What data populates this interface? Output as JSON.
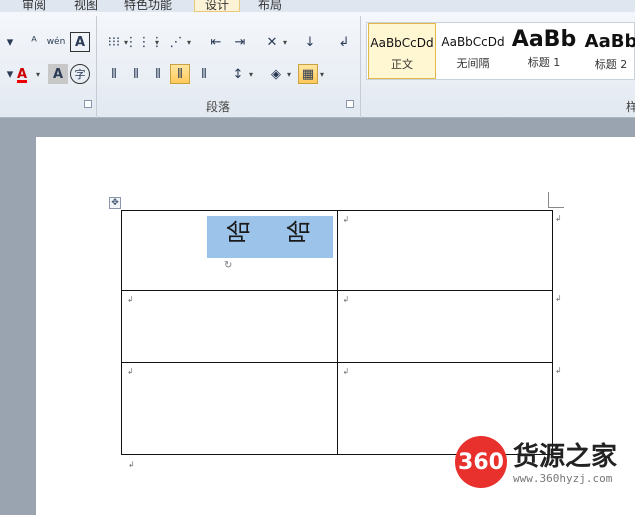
{
  "tabs": [
    "审阅",
    "视图",
    "特色功能",
    "设计",
    "布局"
  ],
  "ribbon": {
    "paragraph_group_label": "段落",
    "styles_group_label_partial": "样",
    "styles": [
      {
        "sample": "AaBbCcDd",
        "name": "正文",
        "selected": true
      },
      {
        "sample": "AaBbCcDd",
        "name": "无间隔",
        "selected": false
      },
      {
        "sample": "AaBb",
        "name": "标题 1",
        "selected": false
      },
      {
        "sample": "AaBb",
        "name": "标题 2",
        "selected": false
      }
    ],
    "font_buttons": {
      "phonetic": "wén",
      "char_border": "A",
      "font_color": "A",
      "char_shading": "A",
      "enclose": "字"
    }
  },
  "document": {
    "selected_text": [
      "哈",
      "哈"
    ],
    "table": {
      "rows": 3,
      "cols": 2
    }
  },
  "watermark": {
    "badge": "360",
    "title": "货源之家",
    "url": "www.360hyzj.com"
  },
  "colors": {
    "accent_red": "#e8302c",
    "selection_blue": "#9cc3ea",
    "pressed_gold": "#ffc95a"
  }
}
